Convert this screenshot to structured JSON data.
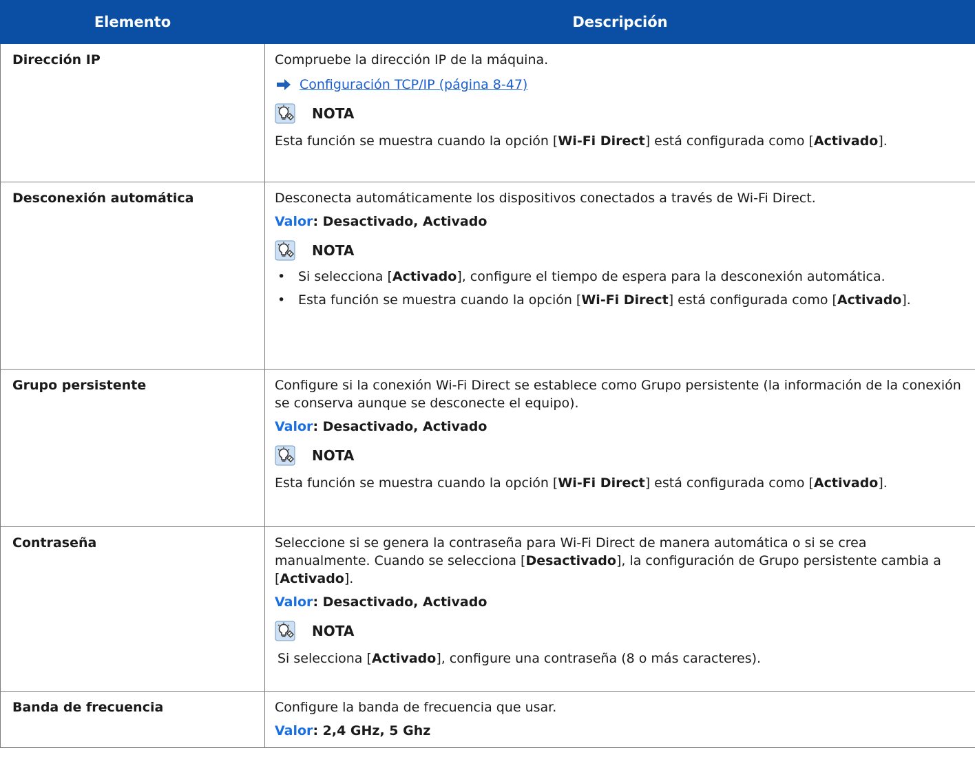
{
  "header": {
    "col1": "Elemento",
    "col2": "Descripción"
  },
  "note_label": "NOTA",
  "valor_label": "Valor",
  "rows": {
    "ip": {
      "name": "Dirección IP",
      "text": "Compruebe la dirección IP de la máquina.",
      "link": "Configuración TCP/IP (página 8-47)",
      "note": {
        "a": "Esta función se muestra cuando la opción [",
        "b": "Wi-Fi Direct",
        "c": "] está configurada como [",
        "d": "Activado",
        "e": "]."
      }
    },
    "auto": {
      "name": "Desconexión automática",
      "text": "Desconecta automáticamente los dispositivos conectados a través de Wi-Fi Direct.",
      "valor": ": Desactivado, Activado",
      "bullet1": {
        "a": "Si selecciona [",
        "b": "Activado",
        "c": "], configure el tiempo de espera para la desconexión automática."
      },
      "bullet2": {
        "a": "Esta función se muestra cuando la opción [",
        "b": "Wi-Fi Direct",
        "c": "] está configurada como [",
        "d": "Activado",
        "e": "]."
      }
    },
    "group": {
      "name": "Grupo persistente",
      "text": "Configure si la conexión Wi-Fi Direct se establece como Grupo persistente (la información de la conexión se conserva aunque se desconecte el equipo).",
      "valor": ": Desactivado, Activado",
      "note": {
        "a": "Esta función se muestra cuando la opción [",
        "b": "Wi-Fi Direct",
        "c": "] está configurada como [",
        "d": "Activado",
        "e": "]."
      }
    },
    "pass": {
      "name": "Contraseña",
      "text": {
        "a": "Seleccione si se genera la contraseña para Wi-Fi Direct de manera automática o si se crea manualmente. Cuando se selecciona [",
        "b": "Desactivado",
        "c": "], la configuración de Grupo persistente cambia a [",
        "d": "Activado",
        "e": "]."
      },
      "valor": ": Desactivado, Activado",
      "note": {
        "a": "Si selecciona [",
        "b": "Activado",
        "c": "], configure una contraseña (8 o más caracteres)."
      }
    },
    "band": {
      "name": "Banda de frecuencia",
      "text": "Configure la banda de frecuencia que usar.",
      "valor": ": 2,4 GHz, 5 Ghz"
    }
  },
  "icons": {
    "arrow": "right-arrow-icon",
    "note": "lightbulb-note-icon"
  },
  "colors": {
    "header_bg": "#0a4fa3",
    "link": "#1a5fd0",
    "valor": "#1a6fe0"
  }
}
